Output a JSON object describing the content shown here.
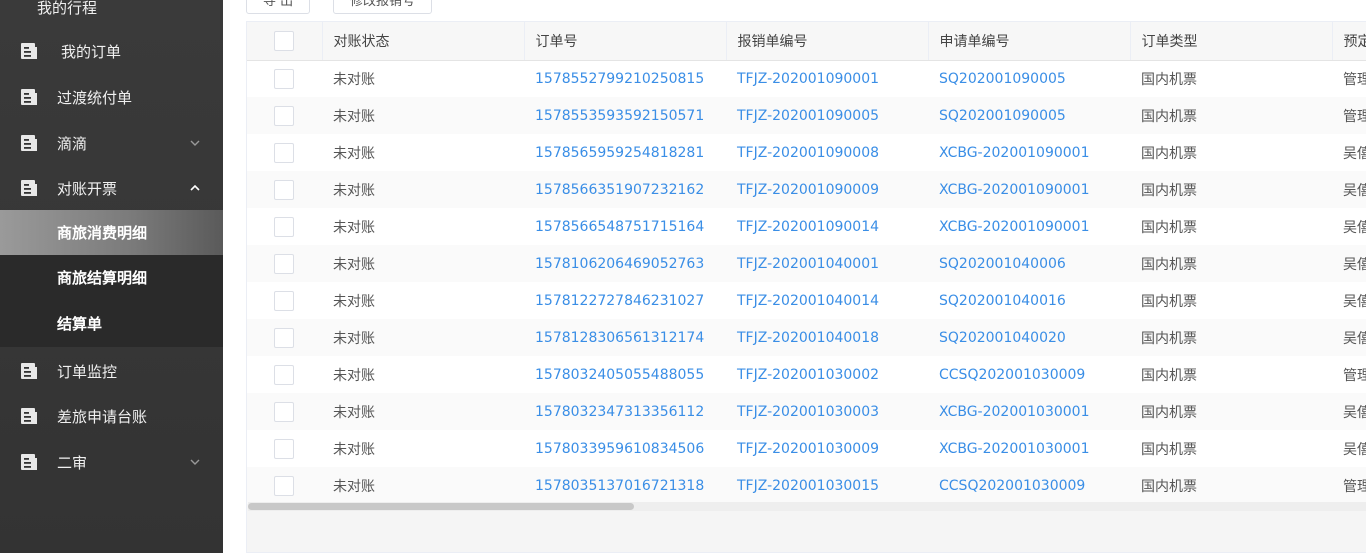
{
  "sidebar": {
    "items": [
      {
        "label": "我的行程",
        "icon": "doc-icon",
        "expanded": null
      },
      {
        "label": "我的订单",
        "icon": "doc-icon",
        "expanded": null
      },
      {
        "label": "过渡统付单",
        "icon": "doc-icon",
        "expanded": null
      },
      {
        "label": "滴滴",
        "icon": "doc-icon",
        "expanded": false
      },
      {
        "label": "对账开票",
        "icon": "doc-icon",
        "expanded": true
      },
      {
        "label": "订单监控",
        "icon": "doc-icon",
        "expanded": null
      },
      {
        "label": "差旅申请台账",
        "icon": "doc-icon",
        "expanded": null
      },
      {
        "label": "二审",
        "icon": "doc-icon",
        "expanded": false
      }
    ],
    "subitems": [
      {
        "label": "商旅消费明细",
        "active": true
      },
      {
        "label": "商旅结算明细",
        "active": false
      },
      {
        "label": "结算单",
        "active": false
      }
    ]
  },
  "toolbar": {
    "btn1": "导 出",
    "btn2": "修改报销号"
  },
  "table": {
    "headers": [
      "对账状态",
      "订单号",
      "报销单编号",
      "申请单编号",
      "订单类型",
      "预定"
    ],
    "rows": [
      [
        "未对账",
        "1578552799210250815",
        "TFJZ-202001090001",
        "SQ202001090005",
        "国内机票",
        "管理"
      ],
      [
        "未对账",
        "1578553593592150571",
        "TFJZ-202001090005",
        "SQ202001090005",
        "国内机票",
        "管理"
      ],
      [
        "未对账",
        "1578565959254818281",
        "TFJZ-202001090008",
        "XCBG-202001090001",
        "国内机票",
        "吴僖"
      ],
      [
        "未对账",
        "1578566351907232162",
        "TFJZ-202001090009",
        "XCBG-202001090001",
        "国内机票",
        "吴僖"
      ],
      [
        "未对账",
        "1578566548751715164",
        "TFJZ-202001090014",
        "XCBG-202001090001",
        "国内机票",
        "吴僖"
      ],
      [
        "未对账",
        "1578106206469052763",
        "TFJZ-202001040001",
        "SQ202001040006",
        "国内机票",
        "吴僖"
      ],
      [
        "未对账",
        "1578122727846231027",
        "TFJZ-202001040014",
        "SQ202001040016",
        "国内机票",
        "吴僖"
      ],
      [
        "未对账",
        "1578128306561312174",
        "TFJZ-202001040018",
        "SQ202001040020",
        "国内机票",
        "吴僖"
      ],
      [
        "未对账",
        "1578032405055488055",
        "TFJZ-202001030002",
        "CCSQ202001030009",
        "国内机票",
        "管理"
      ],
      [
        "未对账",
        "1578032347313356112",
        "TFJZ-202001030003",
        "XCBG-202001030001",
        "国内机票",
        "吴僖"
      ],
      [
        "未对账",
        "1578033959610834506",
        "TFJZ-202001030009",
        "XCBG-202001030001",
        "国内机票",
        "吴僖"
      ],
      [
        "未对账",
        "1578035137016721318",
        "TFJZ-202001030015",
        "CCSQ202001030009",
        "国内机票",
        "管理"
      ]
    ]
  },
  "colors": {
    "link": "#3a8ee6",
    "sidebar_bg": "#333333",
    "active_item": "#8a8a8a"
  }
}
